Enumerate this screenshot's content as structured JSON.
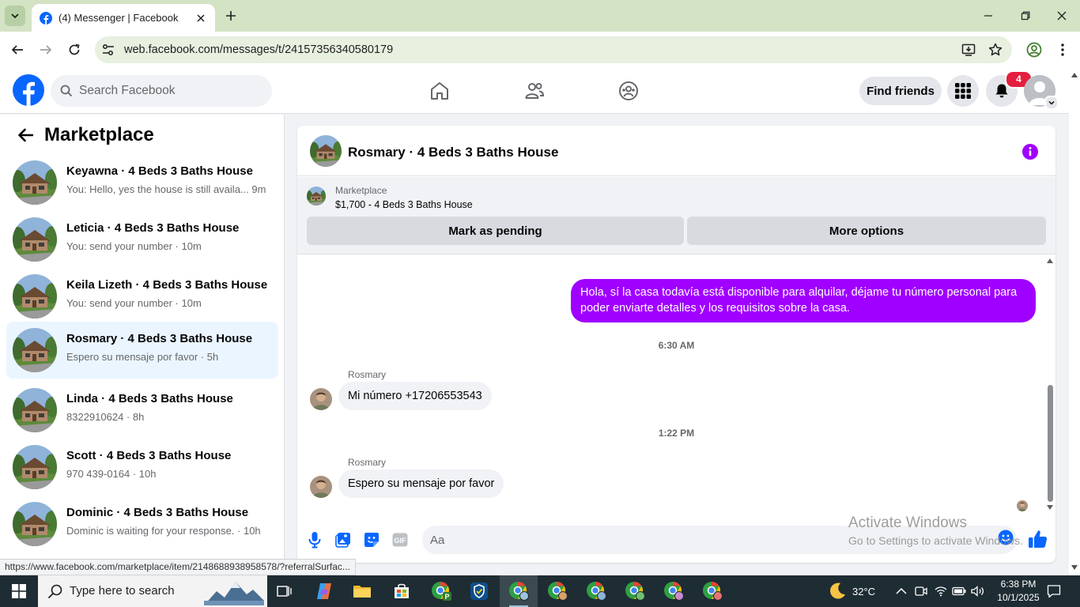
{
  "browser": {
    "tab_title": "(4) Messenger | Facebook",
    "url": "web.facebook.com/messages/t/24157356340580179",
    "status_url": "https://www.facebook.com/marketplace/item/2148688938958578/?referralSurfac..."
  },
  "header": {
    "search_placeholder": "Search Facebook",
    "find_friends_label": "Find friends",
    "notification_count": "4"
  },
  "sidebar": {
    "title": "Marketplace",
    "conversations": [
      {
        "name": "Keyawna · 4 Beds 3 Baths House",
        "snippet": "You: Hello, yes the house is still availa... 9m"
      },
      {
        "name": "Leticia · 4 Beds 3 Baths House",
        "snippet": "You: send your number · 10m"
      },
      {
        "name": "Keila Lizeth · 4 Beds 3 Baths House",
        "snippet": "You: send your number · 10m"
      },
      {
        "name": "Rosmary · 4 Beds 3 Baths House",
        "snippet": "Espero su mensaje por favor · 5h"
      },
      {
        "name": "Linda · 4 Beds 3 Baths House",
        "snippet": "8322910624 · 8h"
      },
      {
        "name": "Scott · 4 Beds 3 Baths House",
        "snippet": "970 439-0164 · 10h"
      },
      {
        "name": "Dominic · 4 Beds 3 Baths House",
        "snippet": "Dominic is waiting for your response. · 10h"
      }
    ]
  },
  "chat": {
    "title": "Rosmary · 4 Beds 3 Baths House",
    "marketplace_label": "Marketplace",
    "item": "$1,700 - 4 Beds 3 Baths House",
    "mark_pending_label": "Mark as pending",
    "more_options_label": "More options",
    "messages": {
      "outgoing_1": "Hola, sí la casa todavía está disponible para alquilar, déjame tu número personal para poder enviarte detalles y los requisitos sobre la casa.",
      "time_1": "6:30 AM",
      "sender_1": "Rosmary",
      "incoming_1": "Mi número +17206553543",
      "time_2": "1:22 PM",
      "sender_2": "Rosmary",
      "incoming_2": "Espero su mensaje por favor"
    },
    "composer_placeholder": "Aa"
  },
  "watermark": {
    "line1": "Activate Windows",
    "line2": "Go to Settings to activate Windows."
  },
  "taskbar": {
    "search_placeholder": "Type here to search",
    "weather": "32°C",
    "time": "6:38 PM",
    "date": "10/1/2025"
  },
  "colors": {
    "fb_blue": "#0866ff",
    "accent_purple": "#a000ff",
    "notif_red": "#e41e3f",
    "chrome_tabbar": "#d3e3c4"
  }
}
